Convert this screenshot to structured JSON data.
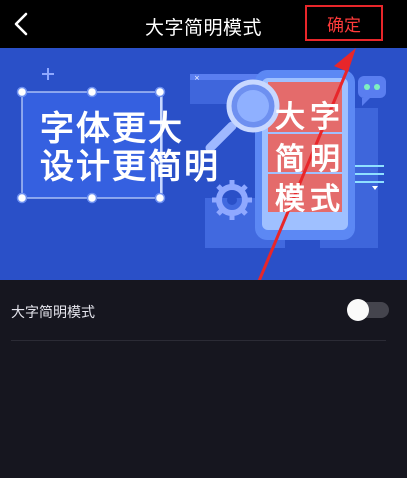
{
  "header": {
    "title": "大字简明模式",
    "confirm_label": "确定",
    "back_icon": "chevron-left-icon"
  },
  "banner": {
    "line1": "字体更大",
    "line2": "设计更简明",
    "phone_chars": [
      "大",
      "字",
      "简",
      "明",
      "模",
      "式"
    ]
  },
  "setting": {
    "label": "大字简明模式",
    "toggle_on": false
  },
  "colors": {
    "background": "#16161f",
    "topbar": "#000000",
    "banner": "#2a50c8",
    "accent_red": "#e8262a",
    "phone_card": "#e46b6b"
  }
}
